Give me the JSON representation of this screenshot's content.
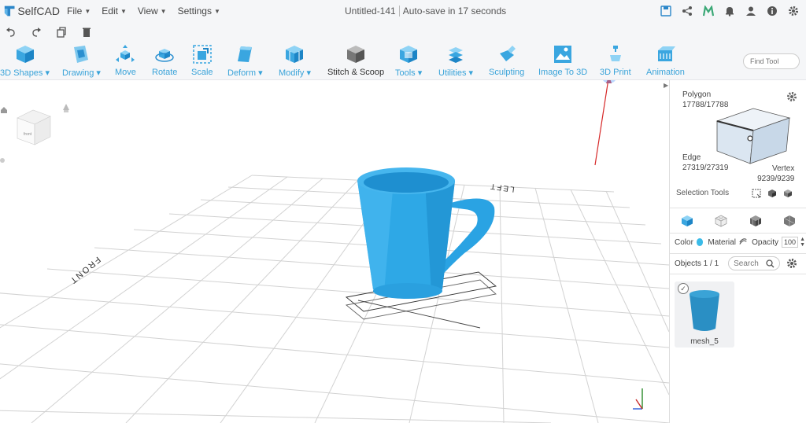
{
  "app": {
    "name": "SelfCAD"
  },
  "menu": [
    {
      "label": "File"
    },
    {
      "label": "Edit"
    },
    {
      "label": "View"
    },
    {
      "label": "Settings"
    }
  ],
  "document": {
    "title": "Untitled-141",
    "autosave": "Auto-save in 17 seconds"
  },
  "topbar_icons": [
    "save-icon",
    "share-icon",
    "m-logo-icon",
    "bell-icon",
    "user-icon",
    "info-icon",
    "settings-icon"
  ],
  "edit_icons": [
    "undo-icon",
    "redo-icon",
    "copy-icon",
    "trash-icon"
  ],
  "ribbon": [
    {
      "id": "3d-shapes",
      "label": "3D Shapes",
      "dropdown": true
    },
    {
      "id": "drawing",
      "label": "Drawing",
      "dropdown": true
    },
    {
      "id": "move",
      "label": "Move",
      "dropdown": false
    },
    {
      "id": "rotate",
      "label": "Rotate",
      "dropdown": false
    },
    {
      "id": "scale",
      "label": "Scale",
      "dropdown": false
    },
    {
      "id": "deform",
      "label": "Deform",
      "dropdown": true
    },
    {
      "id": "modify",
      "label": "Modify",
      "dropdown": true
    },
    {
      "id": "stitch-scoop",
      "label": "Stitch & Scoop",
      "dropdown": false
    },
    {
      "id": "tools",
      "label": "Tools",
      "dropdown": true
    },
    {
      "id": "utilities",
      "label": "Utilities",
      "dropdown": true
    },
    {
      "id": "sculpting",
      "label": "Sculpting",
      "dropdown": false
    },
    {
      "id": "image-to-3d",
      "label": "Image To 3D",
      "dropdown": false
    },
    {
      "id": "3d-print",
      "label": "3D Print",
      "dropdown": false
    },
    {
      "id": "animation",
      "label": "Animation",
      "dropdown": false
    }
  ],
  "find_tool": {
    "placeholder": "Find Tool"
  },
  "viewport": {
    "labels": {
      "front": "FRONT",
      "left": "LEFT"
    },
    "view_cube_label": "front"
  },
  "panel": {
    "polygon": {
      "label": "Polygon",
      "count": "17788/17788"
    },
    "edge": {
      "label": "Edge",
      "count": "27319/27319"
    },
    "vertex": {
      "label": "Vertex",
      "count": "9239/9239"
    },
    "selection_tools": "Selection Tools",
    "color_label": "Color",
    "color_value": "#3bbbe8",
    "material_label": "Material",
    "opacity_label": "Opacity",
    "opacity_value": "100",
    "objects_label": "Objects 1 / 1",
    "search_placeholder": "Search",
    "objects": [
      {
        "name": "mesh_5",
        "selected": true
      }
    ]
  },
  "colors": {
    "accent": "#39a3d9",
    "mug": "#2ea8e6",
    "grid": "#cfcfcf"
  }
}
